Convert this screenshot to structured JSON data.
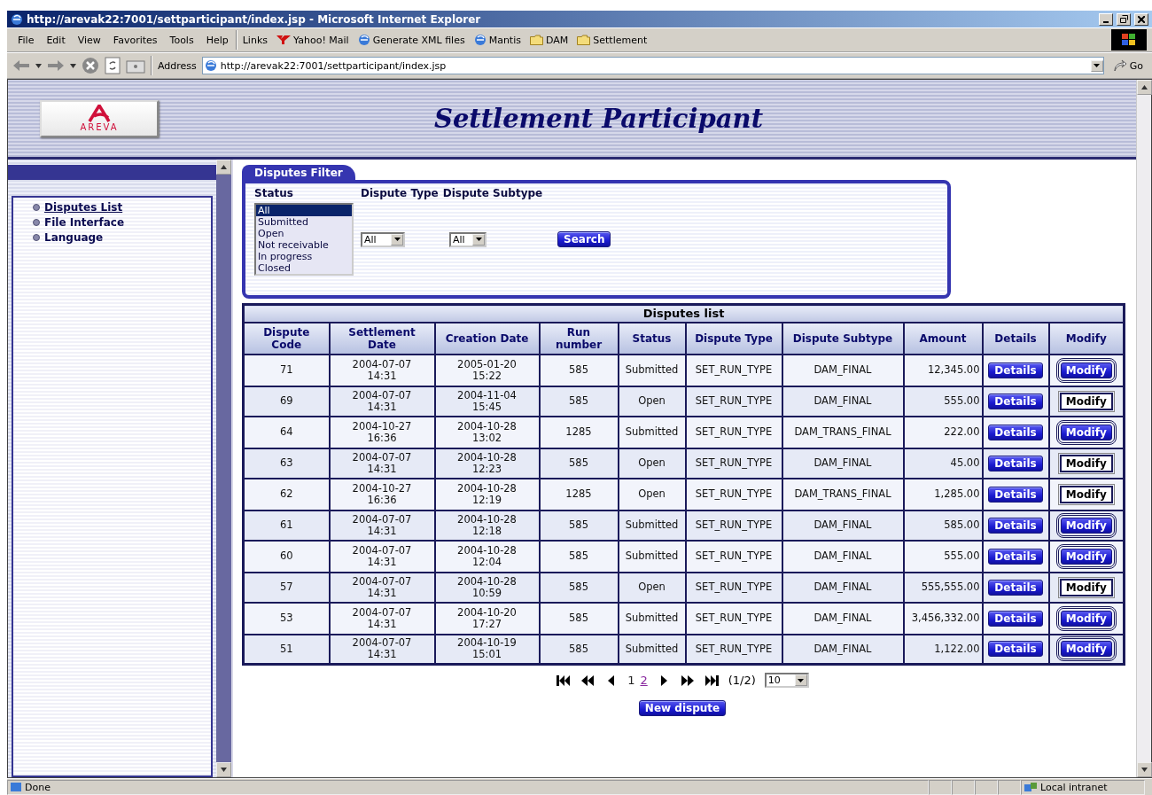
{
  "window": {
    "title": "http://arevak22:7001/settparticipant/index.jsp - Microsoft Internet Explorer"
  },
  "menu": [
    "File",
    "Edit",
    "View",
    "Favorites",
    "Tools",
    "Help"
  ],
  "links": {
    "label": "Links",
    "items": [
      {
        "label": "Yahoo! Mail",
        "kind": "yahoo"
      },
      {
        "label": "Generate XML files",
        "kind": "page"
      },
      {
        "label": "Mantis",
        "kind": "page"
      },
      {
        "label": "DAM",
        "kind": "folder"
      },
      {
        "label": "Settlement",
        "kind": "folder"
      }
    ]
  },
  "address": {
    "label": "Address",
    "value": "http://arevak22:7001/settparticipant/index.jsp",
    "go": "Go"
  },
  "header": {
    "logo": "AREVA",
    "title": "Settlement Participant"
  },
  "sidebar": {
    "items": [
      {
        "label": "Disputes List",
        "selected": true
      },
      {
        "label": "File Interface",
        "selected": false
      },
      {
        "label": "Language",
        "selected": false
      }
    ]
  },
  "filter": {
    "title": "Disputes Filter",
    "status_label": "Status",
    "type_label": "Dispute Type",
    "subtype_label": "Dispute Subtype",
    "status_options": [
      {
        "label": "All",
        "selected": true
      },
      {
        "label": "Submitted",
        "selected": false
      },
      {
        "label": "Open",
        "selected": false
      },
      {
        "label": "Not receivable",
        "selected": false
      },
      {
        "label": "In progress",
        "selected": false
      },
      {
        "label": "Closed",
        "selected": false
      }
    ],
    "type_value": "All",
    "subtype_value": "All",
    "search": "Search"
  },
  "table": {
    "title": "Disputes list",
    "columns": [
      "Dispute\nCode",
      "Settlement\nDate",
      "Creation Date",
      "Run\nnumber",
      "Status",
      "Dispute Type",
      "Dispute Subtype",
      "Amount",
      "Details",
      "Modify"
    ],
    "rows": [
      {
        "code": "71",
        "settlement_date": "2004-07-07\n14:31",
        "creation_date": "2005-01-20\n15:22",
        "run": "585",
        "status": "Submitted",
        "type": "SET_RUN_TYPE",
        "subtype": "DAM_FINAL",
        "amount": "12,345.00",
        "details": "Details",
        "modify": "Modify",
        "modify_active": true
      },
      {
        "code": "69",
        "settlement_date": "2004-07-07\n14:31",
        "creation_date": "2004-11-04\n15:45",
        "run": "585",
        "status": "Open",
        "type": "SET_RUN_TYPE",
        "subtype": "DAM_FINAL",
        "amount": "555.00",
        "details": "Details",
        "modify": "Modify",
        "modify_active": false
      },
      {
        "code": "64",
        "settlement_date": "2004-10-27\n16:36",
        "creation_date": "2004-10-28\n13:02",
        "run": "1285",
        "status": "Submitted",
        "type": "SET_RUN_TYPE",
        "subtype": "DAM_TRANS_FINAL",
        "amount": "222.00",
        "details": "Details",
        "modify": "Modify",
        "modify_active": true
      },
      {
        "code": "63",
        "settlement_date": "2004-07-07\n14:31",
        "creation_date": "2004-10-28\n12:23",
        "run": "585",
        "status": "Open",
        "type": "SET_RUN_TYPE",
        "subtype": "DAM_FINAL",
        "amount": "45.00",
        "details": "Details",
        "modify": "Modify",
        "modify_active": false
      },
      {
        "code": "62",
        "settlement_date": "2004-10-27\n16:36",
        "creation_date": "2004-10-28\n12:19",
        "run": "1285",
        "status": "Open",
        "type": "SET_RUN_TYPE",
        "subtype": "DAM_TRANS_FINAL",
        "amount": "1,285.00",
        "details": "Details",
        "modify": "Modify",
        "modify_active": false
      },
      {
        "code": "61",
        "settlement_date": "2004-07-07\n14:31",
        "creation_date": "2004-10-28\n12:18",
        "run": "585",
        "status": "Submitted",
        "type": "SET_RUN_TYPE",
        "subtype": "DAM_FINAL",
        "amount": "585.00",
        "details": "Details",
        "modify": "Modify",
        "modify_active": true
      },
      {
        "code": "60",
        "settlement_date": "2004-07-07\n14:31",
        "creation_date": "2004-10-28\n12:04",
        "run": "585",
        "status": "Submitted",
        "type": "SET_RUN_TYPE",
        "subtype": "DAM_FINAL",
        "amount": "555.00",
        "details": "Details",
        "modify": "Modify",
        "modify_active": true
      },
      {
        "code": "57",
        "settlement_date": "2004-07-07\n14:31",
        "creation_date": "2004-10-28\n10:59",
        "run": "585",
        "status": "Open",
        "type": "SET_RUN_TYPE",
        "subtype": "DAM_FINAL",
        "amount": "555,555.00",
        "details": "Details",
        "modify": "Modify",
        "modify_active": false
      },
      {
        "code": "53",
        "settlement_date": "2004-07-07\n14:31",
        "creation_date": "2004-10-20\n17:27",
        "run": "585",
        "status": "Submitted",
        "type": "SET_RUN_TYPE",
        "subtype": "DAM_FINAL",
        "amount": "3,456,332.00",
        "details": "Details",
        "modify": "Modify",
        "modify_active": true
      },
      {
        "code": "51",
        "settlement_date": "2004-07-07\n14:31",
        "creation_date": "2004-10-19\n15:01",
        "run": "585",
        "status": "Submitted",
        "type": "SET_RUN_TYPE",
        "subtype": "DAM_FINAL",
        "amount": "1,122.00",
        "details": "Details",
        "modify": "Modify",
        "modify_active": true
      }
    ]
  },
  "pager": {
    "pages": [
      {
        "label": "1",
        "selected": true
      },
      {
        "label": "2",
        "selected": false
      }
    ],
    "count": "(1/2)",
    "page_size": "10"
  },
  "new_button": "New dispute",
  "status_bar": {
    "text": "Done",
    "zone": "Local intranet"
  }
}
